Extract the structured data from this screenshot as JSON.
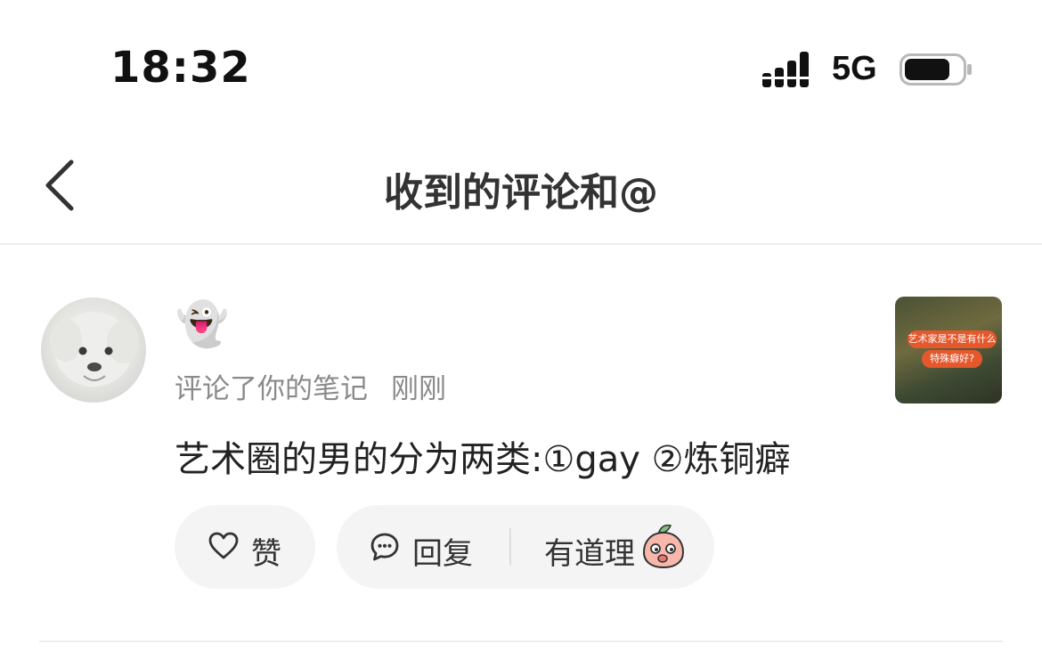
{
  "status_bar": {
    "time": "18:32",
    "network": "5G",
    "icons": [
      "signal-bars-icon",
      "battery-icon"
    ]
  },
  "nav": {
    "title": "收到的评论和@",
    "icons": [
      "chevron-left-icon"
    ]
  },
  "notification": {
    "user_name": "👻",
    "action": "评论了你的笔记",
    "time_ago": "刚刚",
    "comment": "艺术圈的男的分为两类:①gay ②炼铜癖",
    "thumbnail": {
      "line1": "艺术家是不是有什么",
      "line2": "特殊癖好?"
    },
    "actions": {
      "like_label": "赞",
      "reply_label": "回复",
      "quick_reply": "有道理"
    },
    "icons": [
      "heart-icon",
      "chat-bubble-icon",
      "peach-emoji-icon"
    ]
  },
  "colors": {
    "meta_text": "#8a8a8a",
    "pill_bg": "#f4f4f5",
    "thumbnail_label": "#e5582d"
  }
}
